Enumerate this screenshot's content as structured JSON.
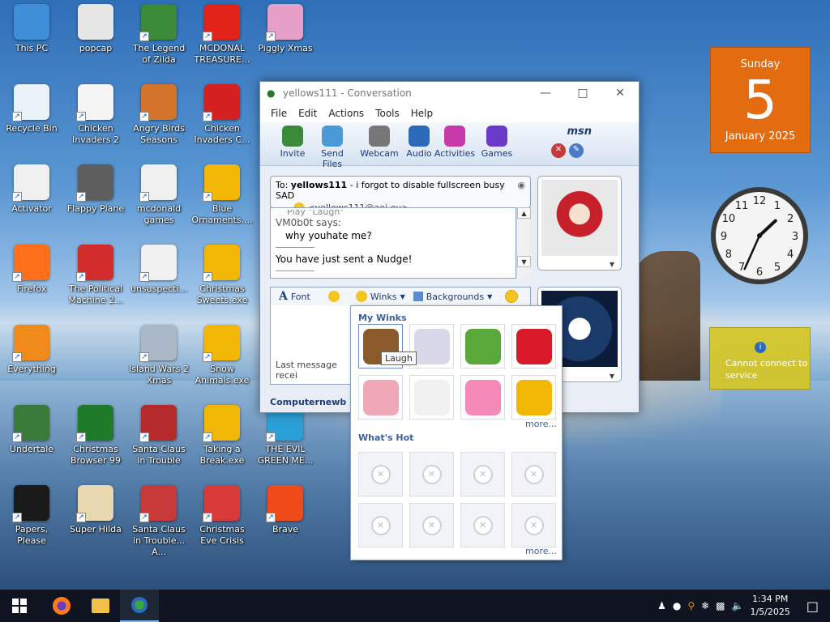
{
  "desktop": {
    "icons": [
      {
        "label": "This PC",
        "color": "#3f8fd8",
        "x": 0
      },
      {
        "label": "popcap",
        "color": "#e6e6e6"
      },
      {
        "label": "The Legend of Zilda",
        "color": "#3a8a3a"
      },
      {
        "label": "MCDONAL TREASURE...",
        "color": "#e2231a"
      },
      {
        "label": "Piggly Xmas",
        "color": "#e4a0c8"
      },
      {
        "label": "Recycle Bin",
        "color": "#eaf2f7"
      },
      {
        "label": "Chicken Invaders 2",
        "color": "#f5f5f5"
      },
      {
        "label": "Angry Birds Seasons",
        "color": "#d4742c"
      },
      {
        "label": "Chicken Invaders C...",
        "color": "#d42020"
      },
      {
        "label": "Activator",
        "color": "#f0f0f0"
      },
      {
        "label": "Flappy Plane",
        "color": "#5e5e5e"
      },
      {
        "label": "mcdonald games",
        "color": "#f0f0f0"
      },
      {
        "label": "Blue Ornaments....",
        "color": "#f2b705"
      },
      {
        "label": "Firefox",
        "color": "#ff6f1a"
      },
      {
        "label": "The Political Machine 2...",
        "color": "#d12b2b"
      },
      {
        "label": "unsuspecti...",
        "color": "#f0f0f0"
      },
      {
        "label": "Christmas Sweets.exe",
        "color": "#f2b705"
      },
      {
        "label": "Everything",
        "color": "#f08a1a"
      },
      {
        "label": "Island Wars 2 Xmas",
        "color": "#aab8c8"
      },
      {
        "label": "Snow Animals.exe",
        "color": "#f2b705"
      },
      {
        "label": "Undertale",
        "color": "#3a7a3a"
      },
      {
        "label": "Christmas Browser 99",
        "color": "#1f7a2a"
      },
      {
        "label": "Santa Claus in Trouble",
        "color": "#b52a2a"
      },
      {
        "label": "Taking a Break.exe",
        "color": "#f2b705"
      },
      {
        "label": "THE EVIL GREEN ME...",
        "color": "#2aa0d8"
      },
      {
        "label": "Papers, Please",
        "color": "#1a1a1a"
      },
      {
        "label": "Super Hilda",
        "color": "#e8d8b0"
      },
      {
        "label": "Santa Claus in Trouble... A...",
        "color": "#c83a3a"
      },
      {
        "label": "Christmas Eve Crisis",
        "color": "#d83a3a"
      },
      {
        "label": "Brave",
        "color": "#f04a1a"
      }
    ]
  },
  "window": {
    "title": "yellows111 - Conversation",
    "menu": [
      "File",
      "Edit",
      "Actions",
      "Tools",
      "Help"
    ],
    "toolbar": [
      {
        "label": "Invite",
        "color": "#3a8a3a"
      },
      {
        "label": "Send Files",
        "color": "#4a9ad8"
      },
      {
        "label": "Webcam",
        "color": "#777777"
      },
      {
        "label": "Audio",
        "color": "#2a6ab8"
      },
      {
        "label": "Activities",
        "color": "#c83aa8"
      },
      {
        "label": "Games",
        "color": "#6a3ac8"
      }
    ],
    "logo": "msn",
    "to_prefix": "To:",
    "to_name": "yellows111",
    "to_message": " - i forgot to disable fullscreen busy SAD",
    "to_email": "<yellows111@aei.ou>",
    "chat": {
      "faded": "Play \"Laugh\"",
      "sender": "VM0b0t says:",
      "message": "why youhate me?",
      "system": "You have just sent a Nudge!"
    },
    "format_bar": {
      "font": "Font",
      "winks": "Winks",
      "backgrounds": "Backgrounds"
    },
    "compose_status": "Last message recei",
    "status_name": "Computernewb I"
  },
  "winks_menu": {
    "my_winks_title": "My Winks",
    "my_winks": [
      {
        "name": "laugh",
        "color": "#8a5a2a"
      },
      {
        "name": "kiss-hand",
        "color": "#d8d8e8"
      },
      {
        "name": "green-dude",
        "color": "#5aa83a"
      },
      {
        "name": "lips",
        "color": "#d81a2a"
      },
      {
        "name": "pig",
        "color": "#f0a8b8"
      },
      {
        "name": "drum",
        "color": "#f0f0f0"
      },
      {
        "name": "heart",
        "color": "#f58ab8"
      },
      {
        "name": "smiley",
        "color": "#f2b705"
      }
    ],
    "tooltip": "Laugh",
    "more1": "more...",
    "whats_hot_title": "What's Hot",
    "whats_hot_count": 8,
    "more2": "more..."
  },
  "gadgets": {
    "calendar": {
      "day": "Sunday",
      "date": "5",
      "month_year": "January 2025"
    },
    "clock": {
      "hour": 1,
      "minute": 34
    },
    "weather": {
      "message": "Cannot connect to service"
    }
  },
  "taskbar": {
    "time": "1:34 PM",
    "date": "1/5/2025"
  }
}
